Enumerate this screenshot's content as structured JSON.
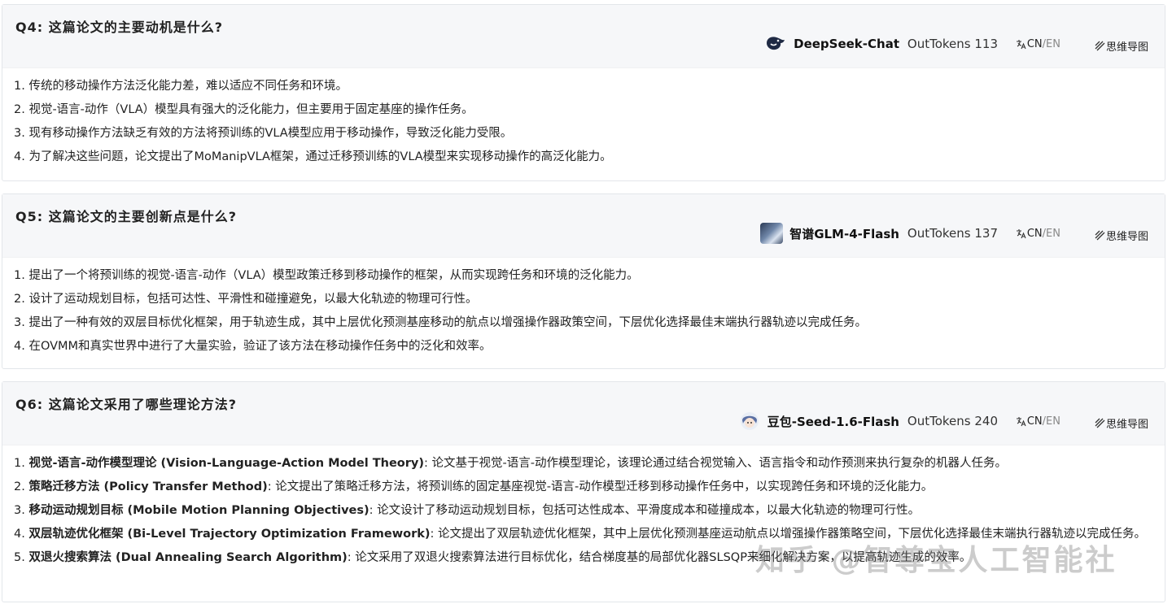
{
  "cards": [
    {
      "title": "Q4: 这篇论文的主要动机是什么?",
      "model": "DeepSeek-Chat",
      "model_icon": "whale-icon",
      "tokens": "OutTokens 113",
      "lang_cn": "CN",
      "lang_sep": "/",
      "lang_en": "EN",
      "mindmap": "思维导图",
      "items": [
        {
          "num": "1.",
          "text": "传统的移动操作方法泛化能力差，难以适应不同任务和环境。"
        },
        {
          "num": "2.",
          "text": "视觉-语言-动作（VLA）模型具有强大的泛化能力，但主要用于固定基座的操作任务。"
        },
        {
          "num": "3.",
          "text": "现有移动操作方法缺乏有效的方法将预训练的VLA模型应用于移动操作，导致泛化能力受限。"
        },
        {
          "num": "4.",
          "text": "为了解决这些问题，论文提出了MoManipVLA框架，通过迁移预训练的VLA模型来实现移动操作的高泛化能力。"
        }
      ]
    },
    {
      "title": "Q5: 这篇论文的主要创新点是什么?",
      "model": "智谱GLM-4-Flash",
      "model_icon": "avatar-icon",
      "tokens": "OutTokens 137",
      "lang_cn": "CN",
      "lang_sep": "/",
      "lang_en": "EN",
      "mindmap": "思维导图",
      "items": [
        {
          "num": "1.",
          "text": "提出了一个将预训练的视觉-语言-动作（VLA）模型政策迁移到移动操作的框架，从而实现跨任务和环境的泛化能力。"
        },
        {
          "num": "2.",
          "text": "设计了运动规划目标，包括可达性、平滑性和碰撞避免，以最大化轨迹的物理可行性。"
        },
        {
          "num": "3.",
          "text": "提出了一种有效的双层目标优化框架，用于轨迹生成，其中上层优化预测基座移动的航点以增强操作器政策空间，下层优化选择最佳末端执行器轨迹以完成任务。"
        },
        {
          "num": "4.",
          "text": "在OVMM和真实世界中进行了大量实验，验证了该方法在移动操作任务中的泛化和效率。"
        }
      ]
    },
    {
      "title": "Q6: 这篇论文采用了哪些理论方法?",
      "model": "豆包-Seed-1.6-Flash",
      "model_icon": "anime-avatar-icon",
      "tokens": "OutTokens 240",
      "lang_cn": "CN",
      "lang_sep": "/",
      "lang_en": "EN",
      "mindmap": "思维导图",
      "items": [
        {
          "num": "1.",
          "bold": "视觉-语言-动作模型理论 (Vision-Language-Action Model Theory)",
          "text": ": 论文基于视觉-语言-动作模型理论，该理论通过结合视觉输入、语言指令和动作预测来执行复杂的机器人任务。"
        },
        {
          "num": "2.",
          "bold": "策略迁移方法 (Policy Transfer Method)",
          "text": ": 论文提出了策略迁移方法，将预训练的固定基座视觉-语言-动作模型迁移到移动操作任务中，以实现跨任务和环境的泛化能力。"
        },
        {
          "num": "3.",
          "bold": "移动运动规划目标 (Mobile Motion Planning Objectives)",
          "text": ": 论文设计了移动运动规划目标，包括可达性成本、平滑度成本和碰撞成本，以最大化轨迹的物理可行性。"
        },
        {
          "num": "4.",
          "bold": "双层轨迹优化框架 (Bi-Level Trajectory Optimization Framework)",
          "text": ": 论文提出了双层轨迹优化框架，其中上层优化预测基座运动航点以增强操作器策略空间，下层优化选择最佳末端执行器轨迹以完成任务。"
        },
        {
          "num": "5.",
          "bold": "双退火搜索算法 (Dual Annealing Search Algorithm)",
          "text": ": 论文采用了双退火搜索算法进行目标优化，结合梯度基的局部优化器SLSQP来细化解决方案，以提高轨迹生成的效率。"
        }
      ]
    }
  ],
  "watermark": "知乎 @智尊宝人工智能社"
}
